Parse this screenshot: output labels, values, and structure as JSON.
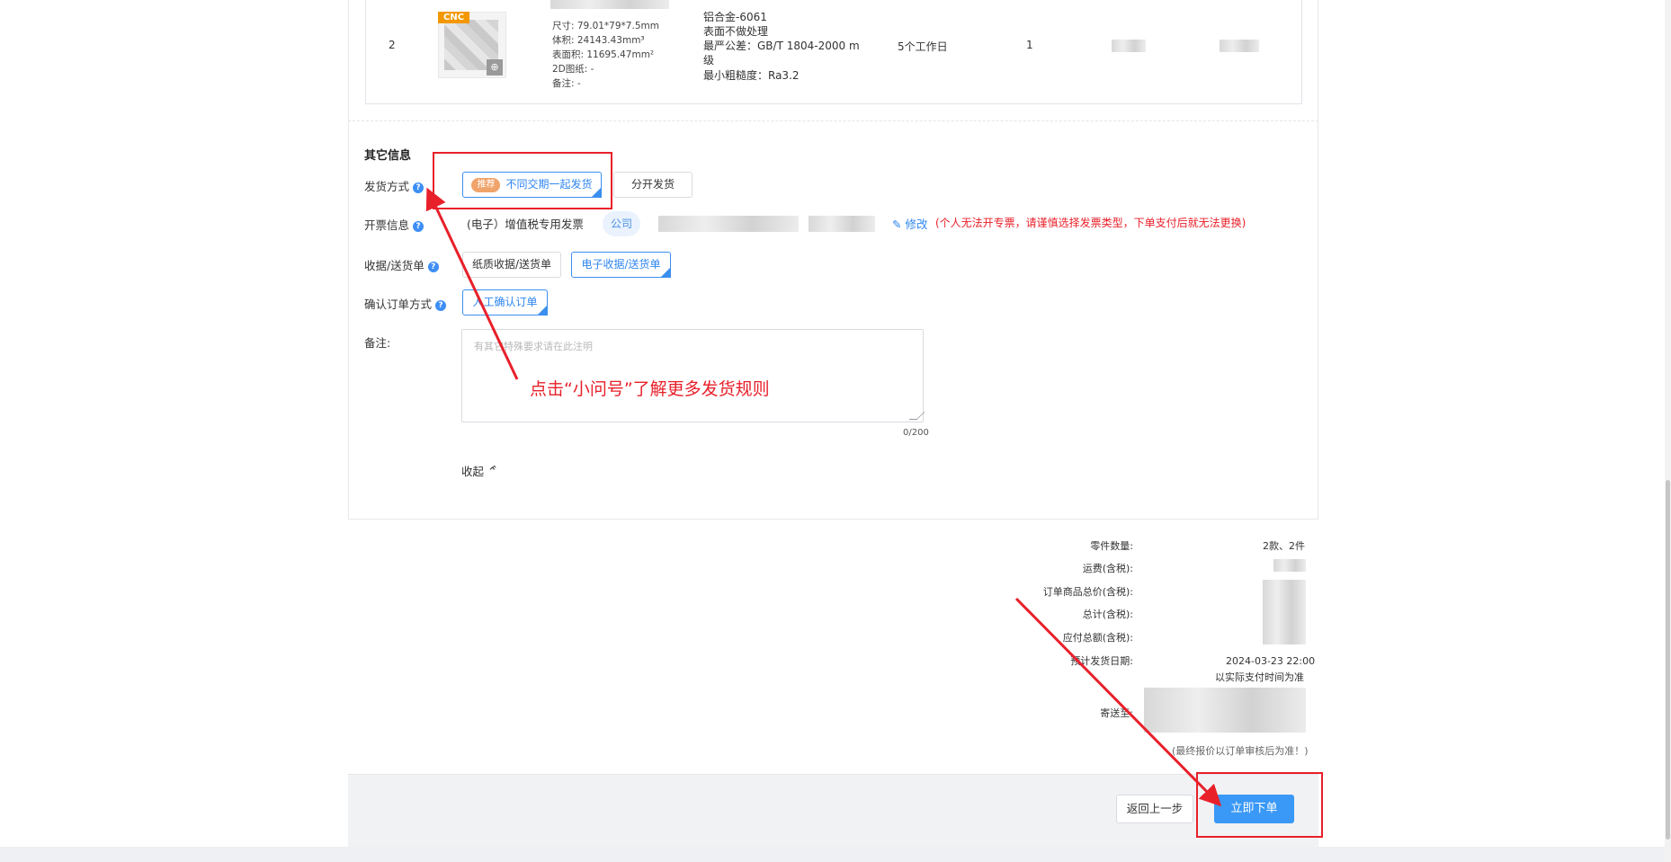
{
  "order_row": {
    "index": "2",
    "badge": "CNC",
    "spec": [
      "尺寸: 79.01*79*7.5mm",
      "体积: 24143.43mm³",
      "表面积: 11695.47mm²",
      "2D图纸: -",
      "备注: -"
    ],
    "material": [
      "铝合金-6061",
      "表面不做处理",
      "最严公差：GB/T 1804-2000 m",
      "级",
      "最小粗糙度：Ra3.2"
    ],
    "lead_time": "5个工作日",
    "quantity": "1"
  },
  "other_info": {
    "title": "其它信息",
    "shipping": {
      "label": "发货方式",
      "recommend_tag": "推荐",
      "option_together": "不同交期一起发货",
      "option_separate": "分开发货"
    },
    "invoice": {
      "label": "开票信息",
      "type": "(电子）增值税专用发票",
      "company_tag": "公司",
      "edit_label": "修改",
      "warning": "(个人无法开专票，请谨慎选择发票类型，下单支付后就无法更换)"
    },
    "receipt": {
      "label": "收据/送货单",
      "option_paper": "纸质收据/送货单",
      "option_electronic": "电子收据/送货单"
    },
    "confirm": {
      "label": "确认订单方式",
      "option_manual": "人工确认订单"
    },
    "remark": {
      "label": "备注:",
      "placeholder": "有其它特殊要求请在此注明",
      "counter": "0/200"
    },
    "collapse_label": "收起"
  },
  "annotation": {
    "text": "点击“小问号”了解更多发货规则",
    "color": "#e8202a"
  },
  "summary": {
    "parts_label": "零件数量:",
    "parts_value": "2款、2件",
    "shipping_fee_label": "运费(含税):",
    "goods_total_label": "订单商品总价(含税):",
    "total_label": "总计(含税):",
    "payable_label": "应付总额(含税):",
    "ship_date_label": "预计发货日期:",
    "ship_date_value": "2024-03-23 22:00",
    "ship_date_note": "以实际支付时间为准",
    "send_to_label": "寄送至:",
    "final_note": "(最终报价以订单审核后为准！)"
  },
  "footer": {
    "back_label": "返回上一步",
    "order_label": "立即下单"
  },
  "colors": {
    "accent": "#3a98f6",
    "annotation_red": "#e8202a",
    "recommend_orange": "#f0a36a",
    "cnc_orange": "#f39800"
  },
  "icons": {
    "help": "help-question-icon",
    "zoom": "zoom-in-icon",
    "edit": "edit-pencil-icon",
    "collapse": "double-chevron-up-icon"
  }
}
